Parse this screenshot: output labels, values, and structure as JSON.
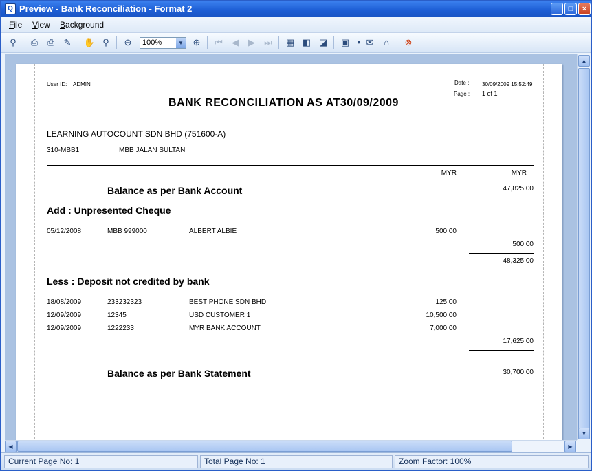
{
  "window": {
    "title": "Preview - Bank Reconciliation - Format 2"
  },
  "menu": [
    "File",
    "View",
    "Background"
  ],
  "toolbar": {
    "zoom_value": "100%"
  },
  "report": {
    "user_label": "User ID:",
    "user_value": "ADMIN",
    "date_label": "Date :",
    "date_value": "30/09/2009 15:52:49",
    "page_label": "Page :",
    "page_value": "1 of 1",
    "title": "BANK  RECONCILIATION  AS  AT",
    "title_date": "30/09/2009",
    "company": "LEARNING AUTOCOUNT SDN BHD (751600-A)",
    "account_code": "310-MBB1",
    "account_name": "MBB JALAN SULTAN",
    "currency_col1": "MYR",
    "currency_col2": "MYR",
    "balance_bank_label": "Balance as per Bank Account",
    "balance_bank_value": "47,825.00",
    "add_section": "Add : Unpresented Cheque",
    "add_rows": [
      {
        "date": "05/12/2008",
        "ref": "MBB 999000",
        "desc": "ALBERT ALBIE",
        "amount": "500.00"
      }
    ],
    "add_total": "500.00",
    "subtotal": "48,325.00",
    "less_section": "Less : Deposit not credited by bank",
    "less_rows": [
      {
        "date": "18/08/2009",
        "ref": "233232323",
        "desc": "BEST PHONE SDN BHD",
        "amount": "125.00"
      },
      {
        "date": "12/09/2009",
        "ref": "12345",
        "desc": "USD CUSTOMER 1",
        "amount": "10,500.00"
      },
      {
        "date": "12/09/2009",
        "ref": "1222233",
        "desc": "MYR BANK ACCOUNT",
        "amount": "7,000.00"
      }
    ],
    "less_total": "17,625.00",
    "balance_statement_label": "Balance as per Bank Statement",
    "balance_statement_value": "30,700.00"
  },
  "status": {
    "current_page": "Current Page No: 1",
    "total_page": "Total Page No: 1",
    "zoom": "Zoom Factor: 100%"
  },
  "colors": {
    "title_bar": "#1e5fd6",
    "viewport_bg": "#aac2e2",
    "toolbar_bg": "#d7e5f6"
  }
}
